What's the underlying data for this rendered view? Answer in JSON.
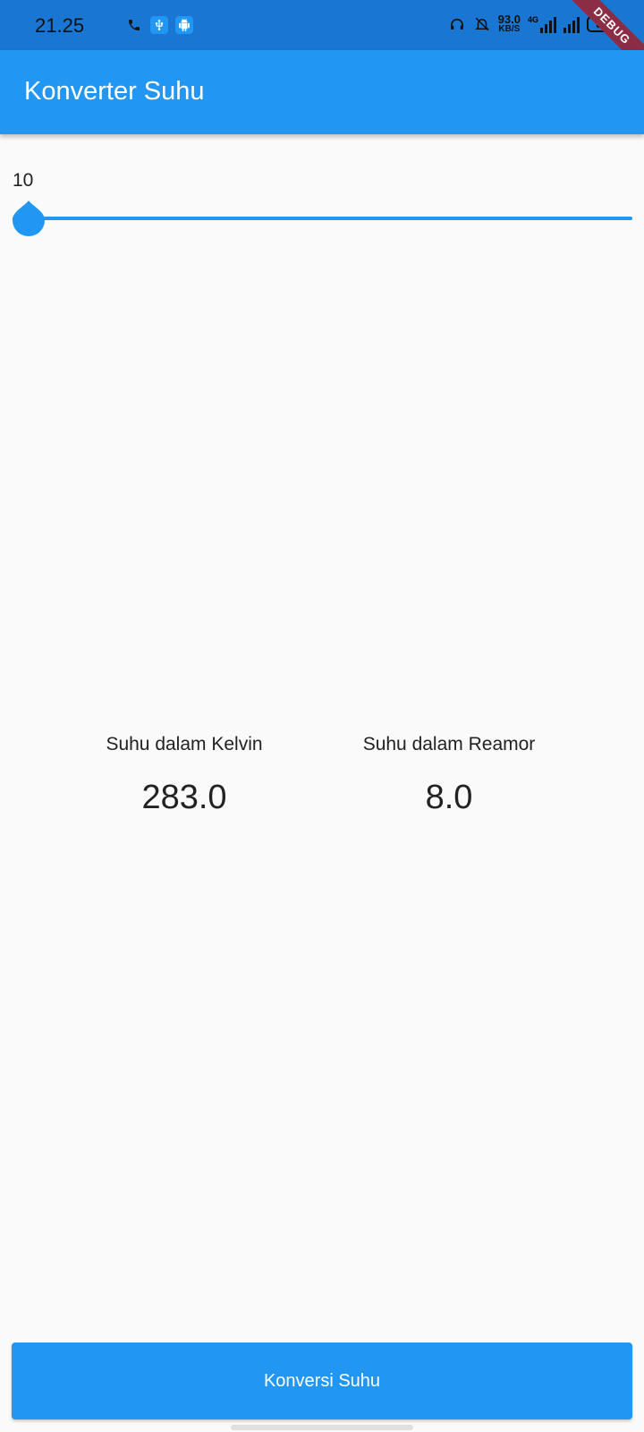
{
  "status_bar": {
    "time": "21.25",
    "net_speed_value": "93.0",
    "net_speed_unit": "KB/S",
    "network_type": "4G",
    "battery": "82",
    "icons": [
      "phone-icon",
      "usb-icon",
      "android-icon",
      "headphones-icon",
      "mute-icon",
      "signal-icon",
      "battery-icon"
    ]
  },
  "debug_banner": "DEBUG",
  "app_bar": {
    "title": "Konverter Suhu"
  },
  "slider": {
    "value_label": "10",
    "value": 10,
    "accent_color": "#2196f3"
  },
  "results": [
    {
      "label": "Suhu dalam Kelvin",
      "value": "283.0"
    },
    {
      "label": "Suhu dalam Reamor",
      "value": "8.0"
    }
  ],
  "convert_button": {
    "label": "Konversi Suhu"
  }
}
